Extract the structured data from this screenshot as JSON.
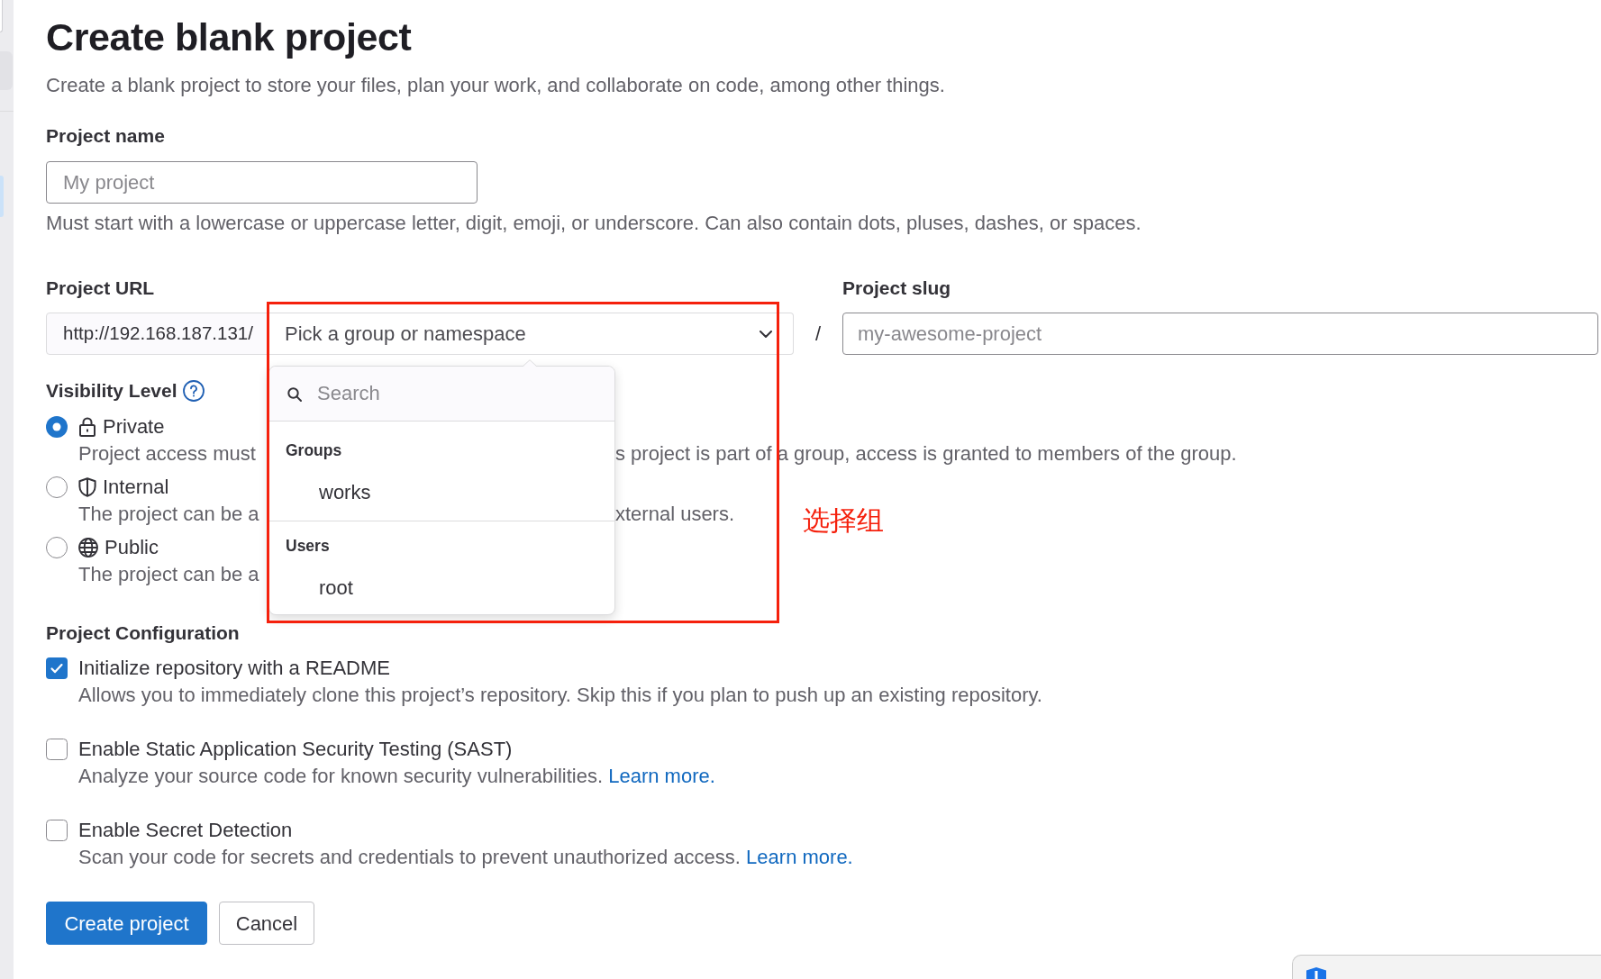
{
  "header": {
    "title": "Create blank project",
    "description": "Create a blank project to store your files, plan your work, and collaborate on code, among other things."
  },
  "project_name": {
    "label": "Project name",
    "placeholder": "My project",
    "help": "Must start with a lowercase or uppercase letter, digit, emoji, or underscore. Can also contain dots, pluses, dashes, or spaces."
  },
  "project_url": {
    "label": "Project URL",
    "prefix": "http://192.168.187.131/",
    "namespace_select": {
      "placeholder": "Pick a group or namespace",
      "expanded": true
    },
    "separator": "/"
  },
  "namespace_menu": {
    "search_placeholder": "Search",
    "sections": [
      {
        "heading": "Groups",
        "items": [
          "works"
        ]
      },
      {
        "heading": "Users",
        "items": [
          "root"
        ]
      }
    ]
  },
  "project_slug": {
    "label": "Project slug",
    "placeholder": "my-awesome-project"
  },
  "visibility": {
    "label": "Visibility Level",
    "options": [
      {
        "label": "Private",
        "selected": true,
        "description": [
          "Project access must",
          "s project is part of a group, access is granted to members of the group."
        ]
      },
      {
        "label": "Internal",
        "selected": false,
        "description": [
          "The project can be a",
          "xternal users."
        ]
      },
      {
        "label": "Public",
        "selected": false,
        "description": [
          "The project can be a"
        ]
      }
    ]
  },
  "configuration": {
    "label": "Project Configuration",
    "options": [
      {
        "label": "Initialize repository with a README",
        "checked": true,
        "description": "Allows you to immediately clone this project’s repository. Skip this if you plan to push up an existing repository."
      },
      {
        "label": "Enable Static Application Security Testing (SAST)",
        "checked": false,
        "description": "Analyze your source code for known security vulnerabilities.",
        "link": "Learn more."
      },
      {
        "label": "Enable Secret Detection",
        "checked": false,
        "description": "Scan your code for secrets and credentials to prevent unauthorized access.",
        "link": "Learn more."
      }
    ]
  },
  "buttons": [
    {
      "label": "Create project",
      "kind": "primary"
    },
    {
      "label": "Cancel",
      "kind": "secondary"
    }
  ],
  "annotation": {
    "note": "选择组"
  }
}
